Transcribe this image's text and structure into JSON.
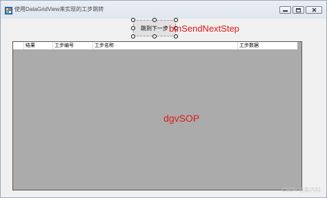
{
  "window": {
    "title": "使用DataGridView来实现的工步跳转"
  },
  "designer": {
    "button_text": "跳到下一步",
    "button_name_label": "btnSendNextStep",
    "grid_name_label": "dgvSOP"
  },
  "grid": {
    "columns": [
      "结果",
      "工步编号",
      "工步名称",
      "工步数据"
    ]
  },
  "watermark": "CSDN @斯内科",
  "colors": {
    "label_red": "#e01818",
    "grid_background": "#ababab",
    "form_background": "#f0f0f0"
  },
  "icons": {
    "app": "app-icon",
    "minimize": "minimize-icon",
    "maximize": "maximize-icon",
    "close": "close-icon"
  }
}
